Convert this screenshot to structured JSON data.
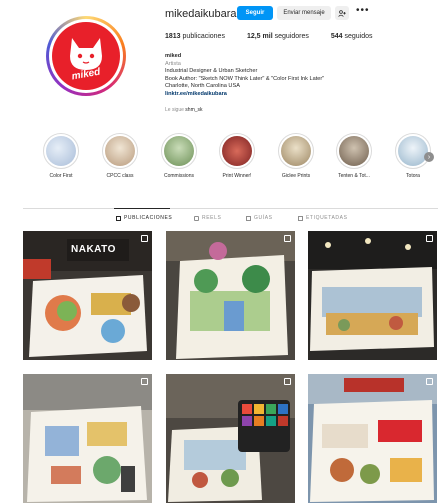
{
  "profile": {
    "username": "mikedaikubara",
    "follow_label": "Seguir",
    "message_label": "Enviar mensaje",
    "avatar_text": "miked"
  },
  "stats": {
    "posts_count": "1813",
    "posts_label": "publicaciones",
    "followers_count": "12,5 mil",
    "followers_label": "seguidores",
    "following_count": "544",
    "following_label": "seguidos"
  },
  "bio": {
    "name": "miked",
    "category": "Artista",
    "line1": "Industrial Designer & Urban Sketcher",
    "line2": "Book Author: \"Sketch NOW Think Later\" & \"Color First Ink Later\"",
    "line3": "Charlotte, North Carolina USA",
    "link": "linktr.ee/mikedaikubara",
    "followed_prefix": "Le sigue",
    "followed_user": "shm_sk"
  },
  "highlights": [
    {
      "label": "Color First",
      "color": "#b8cbe4"
    },
    {
      "label": "CPCC class",
      "color": "#d9c7b0"
    },
    {
      "label": "Commissions",
      "color": "#8fae7a"
    },
    {
      "label": "Print Winner!",
      "color": "#b53a3a"
    },
    {
      "label": "Giclee Prints",
      "color": "#c8b89c"
    },
    {
      "label": "Tenten & Tot...",
      "color": "#a09080"
    },
    {
      "label": "Totora",
      "color": "#c4d7e6"
    }
  ],
  "tabs": [
    {
      "label": "PUBLICACIONES",
      "active": true
    },
    {
      "label": "REELS",
      "active": false
    },
    {
      "label": "GUÍAS",
      "active": false
    },
    {
      "label": "ETIQUETADAS",
      "active": false
    }
  ],
  "posts": {
    "post1_sign": "NAKATO"
  },
  "colors": {
    "accent": "#0095f6",
    "avatar_bg": "#e8202a",
    "link": "#00376b"
  }
}
